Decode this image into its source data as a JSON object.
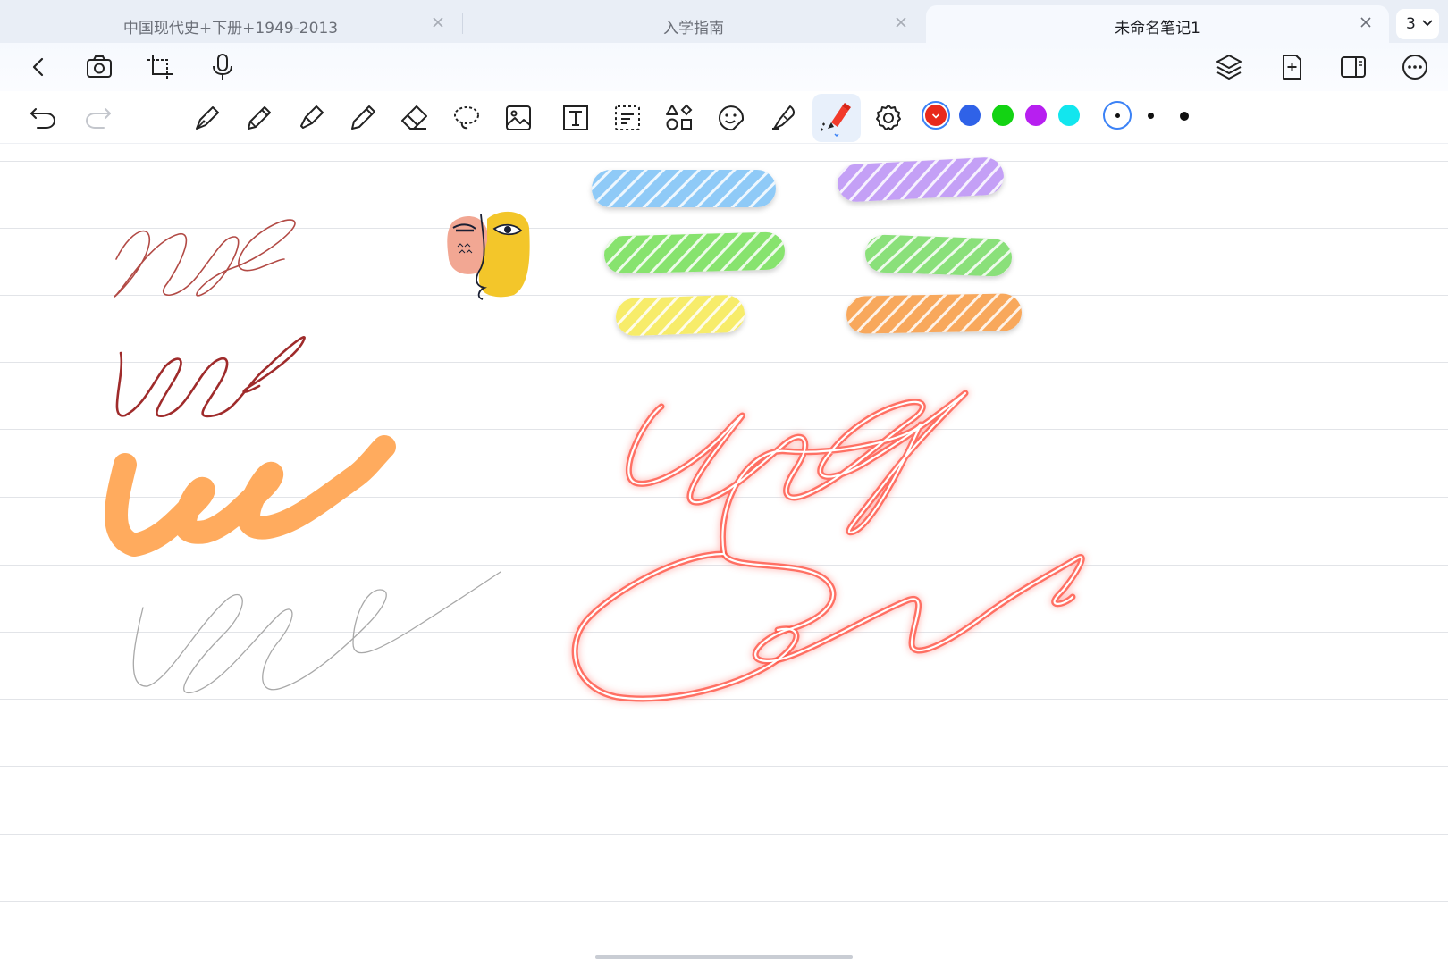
{
  "tabs": [
    {
      "label": "中国现代史+下册+1949-2013",
      "active": false
    },
    {
      "label": "入学指南",
      "active": false
    },
    {
      "label": "未命名笔记1",
      "active": true
    }
  ],
  "tab_count": "3",
  "toolbar": {
    "colors": [
      "#e8291c",
      "#2f62e8",
      "#13d313",
      "#b71ff0",
      "#12e6ee"
    ],
    "selected_color": "#e8291c",
    "stroke_sizes": [
      "small",
      "medium",
      "large"
    ],
    "selected_size": "small",
    "active_tool": "neon-pen"
  },
  "canvas": {
    "accent_highlighters": [
      "#8fcaf7",
      "#c4a0f6",
      "#87e36e",
      "#8ae07a",
      "#f7ec6a",
      "#f8a85c"
    ],
    "ink_colors": [
      "#b24a45",
      "#9f2b2b",
      "#ffab5e",
      "#a8a8a8",
      "#ff5a4a"
    ]
  }
}
